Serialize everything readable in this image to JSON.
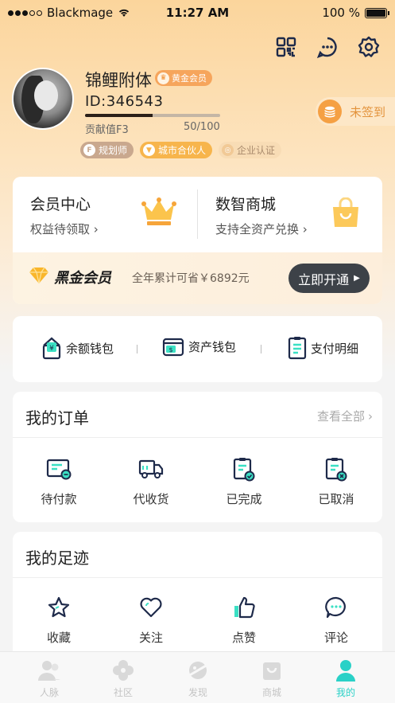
{
  "status_bar": {
    "carrier": "Blackmage",
    "time": "11:27 AM",
    "battery": "100 %"
  },
  "top_icons": [
    "qr-code-icon",
    "message-icon",
    "settings-icon"
  ],
  "profile": {
    "name": "锦鲤附体",
    "member_tag": "黄金会员",
    "user_id": "ID:346543",
    "contribution_label": "贡献值F3",
    "contribution_count": "50/100",
    "contribution_progress": 0.5,
    "roles": [
      "规划师",
      "城市合伙人",
      "企业认证"
    ],
    "checkin_label": "未签到"
  },
  "member_card": {
    "left_title": "会员中心",
    "left_sub": "权益待领取",
    "right_title": "数智商城",
    "right_sub": "支持全资产兑换",
    "vip_name": "黑金会员",
    "vip_desc": "全年累计可省￥6892元",
    "vip_button": "立即开通"
  },
  "wallets": [
    "余额钱包",
    "资产钱包",
    "支付明细"
  ],
  "orders": {
    "title": "我的订单",
    "more": "查看全部",
    "items": [
      "待付款",
      "代收货",
      "已完成",
      "已取消"
    ]
  },
  "footprint": {
    "title": "我的足迹",
    "items": [
      "收藏",
      "关注",
      "点赞",
      "评论"
    ]
  },
  "tabbar": {
    "items": [
      "人脉",
      "社区",
      "发现",
      "商城",
      "我的"
    ],
    "active": "我的",
    "active_color": "#2ad1c7"
  },
  "colors": {
    "accent_orange": "#f6a55c",
    "navy": "#1e2a4a",
    "teal": "#3be0c4"
  }
}
